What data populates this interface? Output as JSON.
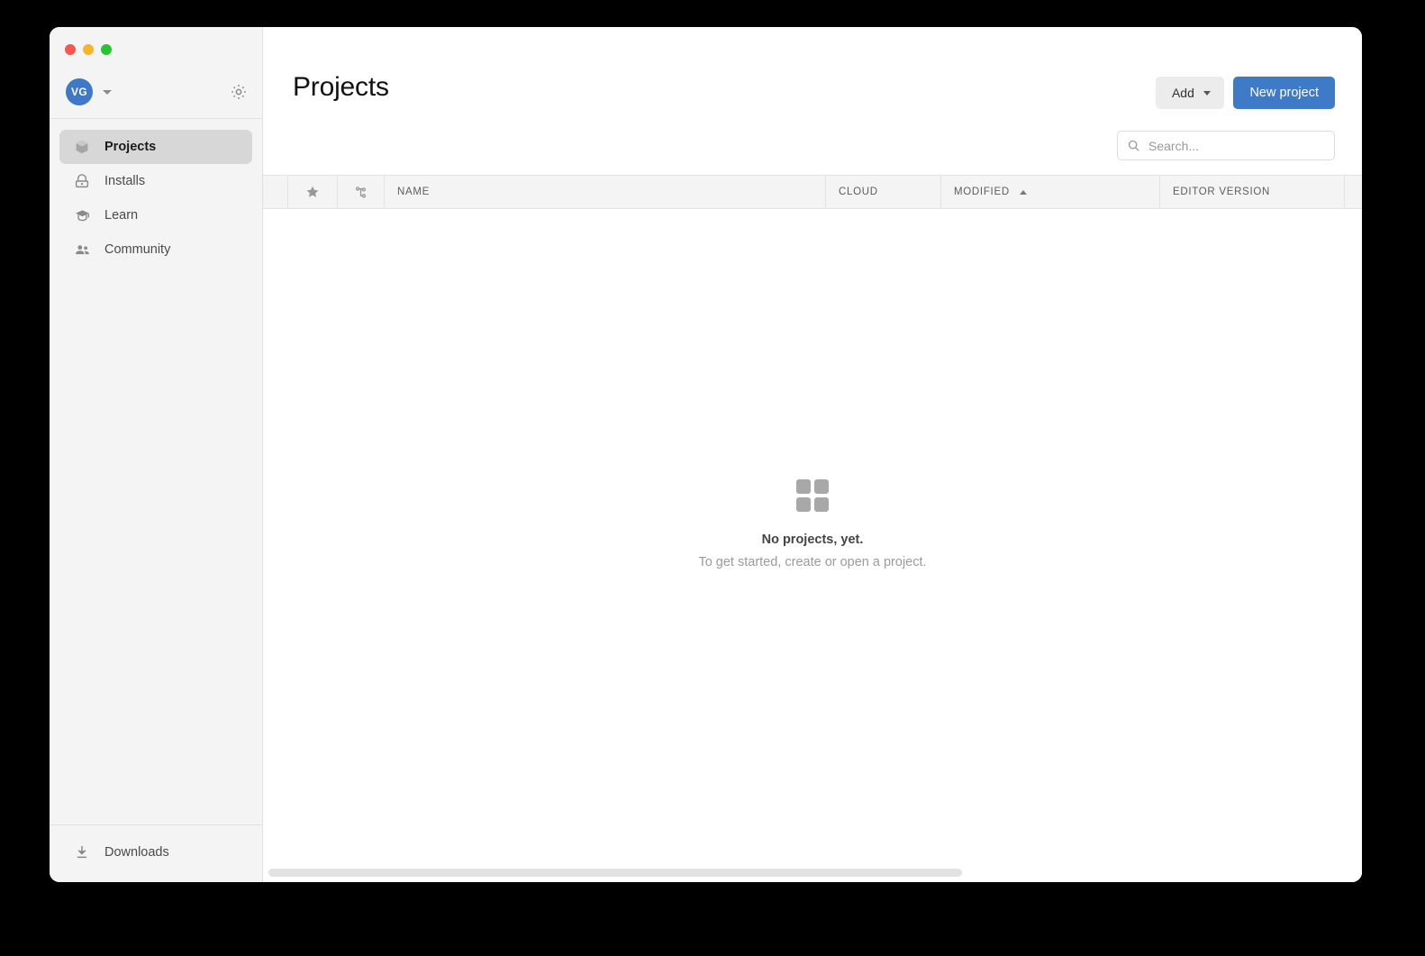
{
  "window": {
    "traffic_lights": [
      {
        "name": "close",
        "color": "#f9564f"
      },
      {
        "name": "minimize",
        "color": "#f9b42d"
      },
      {
        "name": "maximize",
        "color": "#25c630"
      }
    ]
  },
  "sidebar": {
    "account": {
      "avatar_initials": "VG",
      "avatar_color": "#4078c8",
      "dropdown_icon": "chevron-down-icon",
      "settings_icon": "gear-icon"
    },
    "items": [
      {
        "label": "Projects",
        "icon": "cube-icon",
        "active": true
      },
      {
        "label": "Installs",
        "icon": "install-icon",
        "active": false
      },
      {
        "label": "Learn",
        "icon": "graduation-cap-icon",
        "active": false
      },
      {
        "label": "Community",
        "icon": "people-icon",
        "active": false
      }
    ],
    "footer": {
      "label": "Downloads",
      "icon": "download-icon"
    }
  },
  "header": {
    "title": "Projects",
    "add_label": "Add",
    "new_project_label": "New project",
    "new_project_color": "#3f7ac9",
    "add_color": "#ececec"
  },
  "search": {
    "value": "",
    "placeholder": "Search...",
    "icon": "search-icon"
  },
  "table": {
    "columns": [
      {
        "key": "spacer",
        "label": "",
        "icon": null
      },
      {
        "key": "favorite",
        "label": "",
        "icon": "star-icon"
      },
      {
        "key": "vcs",
        "label": "",
        "icon": "version-control-icon"
      },
      {
        "key": "name",
        "label": "NAME",
        "icon": null
      },
      {
        "key": "cloud",
        "label": "CLOUD",
        "icon": null
      },
      {
        "key": "modified",
        "label": "MODIFIED",
        "icon": "sort-ascending-icon",
        "sorted": "asc"
      },
      {
        "key": "editor",
        "label": "EDITOR VERSION",
        "icon": null
      }
    ],
    "rows": []
  },
  "empty_state": {
    "icon": "grid-squares-icon",
    "title": "No projects, yet.",
    "subtitle": "To get started, create or open a project."
  },
  "scrollbar": {
    "orientation": "horizontal",
    "thumb_color": "#e2e2e2"
  }
}
